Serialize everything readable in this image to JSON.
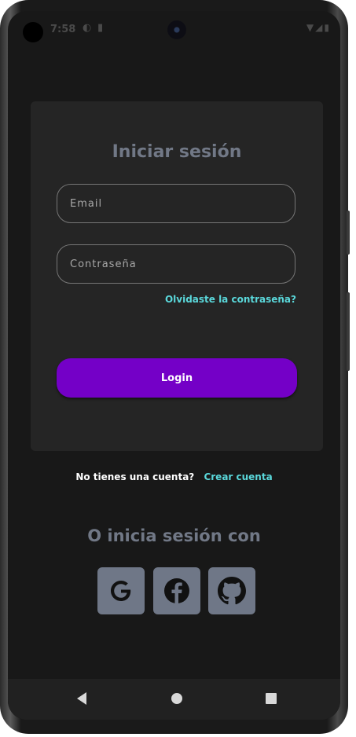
{
  "status_bar": {
    "time": "7:58",
    "left_icons": [
      "data-saver-icon",
      "sim-card-icon"
    ],
    "right_icons": [
      "wifi-icon",
      "cell-signal-icon",
      "battery-icon"
    ]
  },
  "login_card": {
    "title": "Iniciar sesión",
    "email_placeholder": "Email",
    "password_placeholder": "Contraseña",
    "forgot_password": "Olvidaste la contraseña?",
    "login_button": "Login"
  },
  "signup": {
    "question": "No tienes una cuenta?",
    "link": "Crear cuenta"
  },
  "alt_login": {
    "title": "O inicia sesión con",
    "providers": [
      "google-icon",
      "facebook-icon",
      "github-icon"
    ]
  },
  "nav_bar": {
    "buttons": [
      "back-icon",
      "home-icon",
      "recents-icon"
    ]
  },
  "colors": {
    "background": "#181818",
    "card": "#252525",
    "accent_purple": "#7400c7",
    "link_cyan": "#5ad8db",
    "title_gray": "#717886",
    "social_button": "#6f7787"
  }
}
